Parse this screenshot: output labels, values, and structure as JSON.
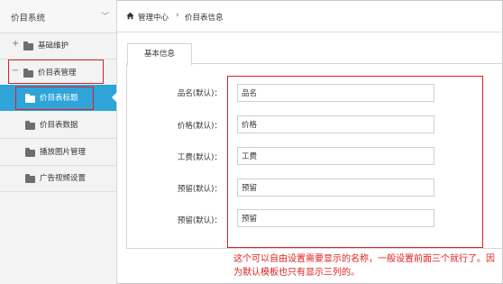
{
  "sidebar": {
    "title": "价目系统",
    "items": [
      {
        "label": "基础维护",
        "expander": "+"
      },
      {
        "label": "价目表管理",
        "expander": "−"
      },
      {
        "label": "价目表标题"
      },
      {
        "label": "价目表数据"
      },
      {
        "label": "播放图片管理"
      },
      {
        "label": "广告视频设置"
      }
    ]
  },
  "breadcrumb": {
    "home": "管理中心",
    "separator": "›",
    "current": "价目表信息"
  },
  "tabs": [
    {
      "label": "基本信息"
    }
  ],
  "form": {
    "fields": [
      {
        "label": "品名(默认)：",
        "value": "品名"
      },
      {
        "label": "价格(默认)：",
        "value": "价格"
      },
      {
        "label": "工费(默认)：",
        "value": "工费"
      },
      {
        "label": "预留(默认)：",
        "value": "预留"
      },
      {
        "label": "预留(默认)：",
        "value": "预留"
      }
    ]
  },
  "annotation": "这个可以自由设置需要显示的名称，一般设置前面三个就行了。因为默认模板也只有显示三列的。",
  "colors": {
    "accent": "#2fa4d8",
    "highlight": "#e02020"
  }
}
